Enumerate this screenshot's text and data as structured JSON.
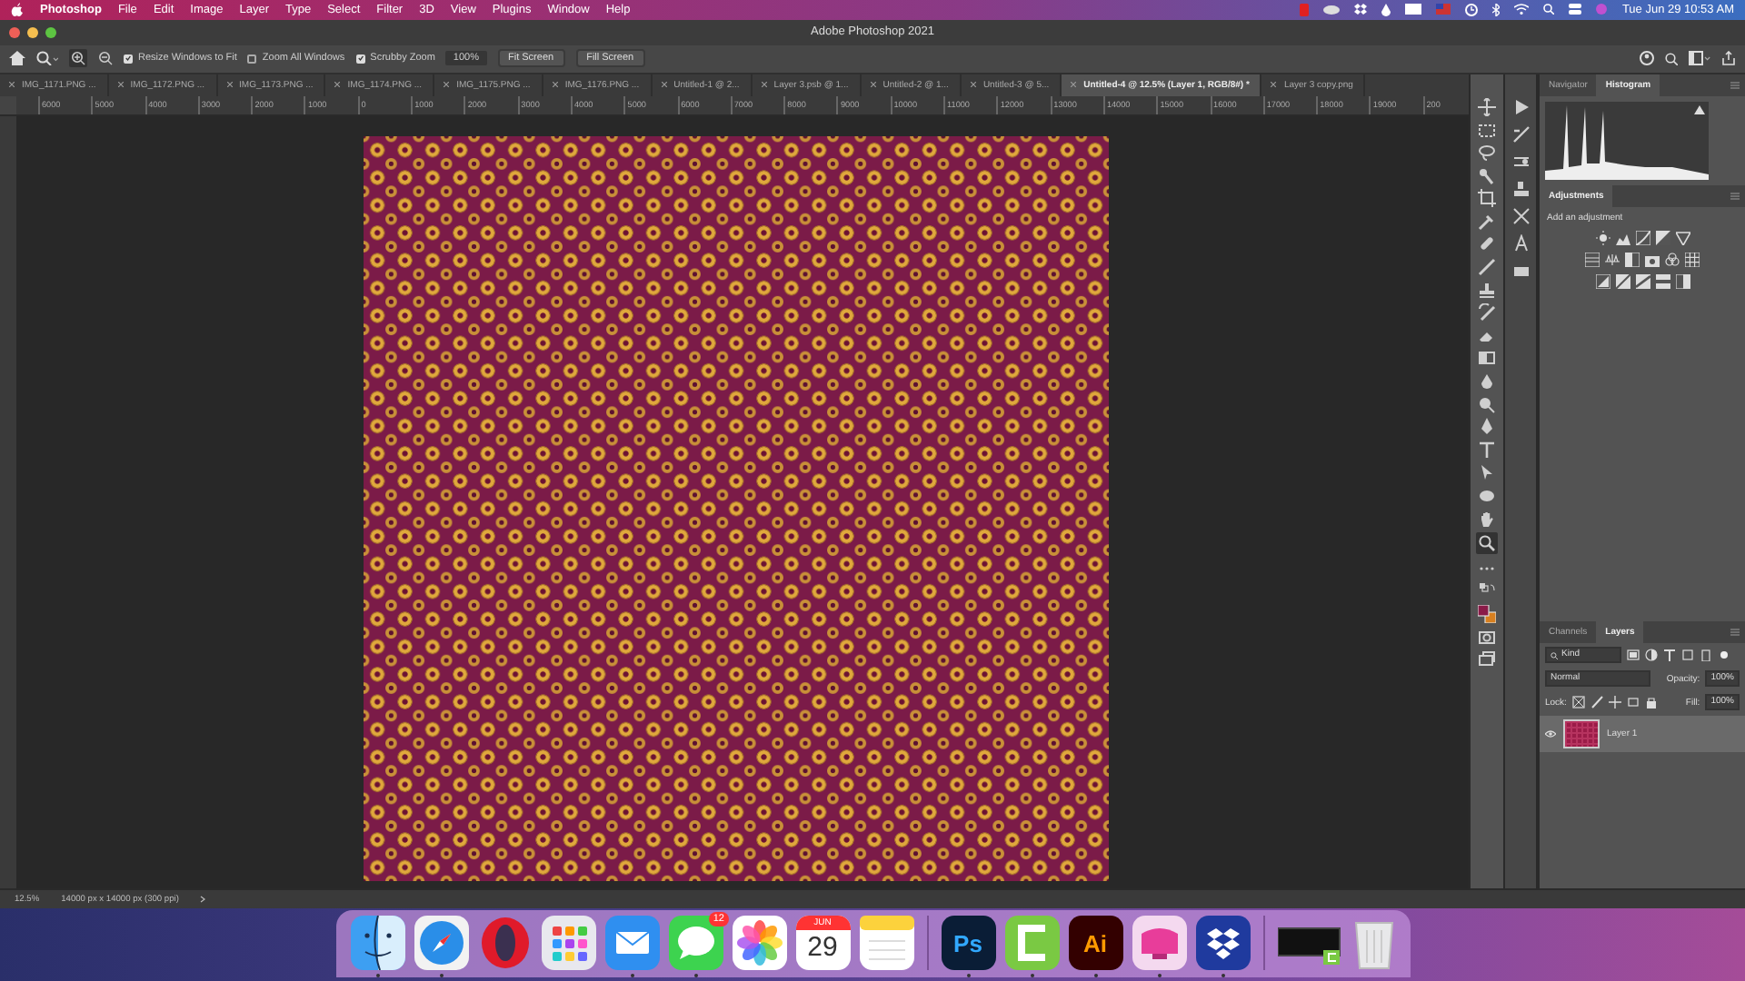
{
  "menu_bar": {
    "app": "Photoshop",
    "items": [
      "File",
      "Edit",
      "Image",
      "Layer",
      "Type",
      "Select",
      "Filter",
      "3D",
      "View",
      "Plugins",
      "Window",
      "Help"
    ],
    "clock": "Tue Jun 29  10:53 AM"
  },
  "window": {
    "title": "Adobe Photoshop 2021"
  },
  "options_bar": {
    "checkboxes": [
      {
        "label": "Resize Windows to Fit",
        "checked": true
      },
      {
        "label": "Zoom All Windows",
        "checked": false
      },
      {
        "label": "Scrubby Zoom",
        "checked": true
      }
    ],
    "zoom_value": "100%",
    "buttons": [
      "Fit Screen",
      "Fill Screen"
    ]
  },
  "tabs": [
    {
      "label": "IMG_1171.PNG ...",
      "selected": false
    },
    {
      "label": "IMG_1172.PNG ...",
      "selected": false
    },
    {
      "label": "IMG_1173.PNG ...",
      "selected": false
    },
    {
      "label": "IMG_1174.PNG ...",
      "selected": false
    },
    {
      "label": "IMG_1175.PNG ...",
      "selected": false
    },
    {
      "label": "IMG_1176.PNG ...",
      "selected": false
    },
    {
      "label": "Untitled-1 @ 2...",
      "selected": false
    },
    {
      "label": "Layer 3.psb @ 1...",
      "selected": false
    },
    {
      "label": "Untitled-2 @ 1...",
      "selected": false
    },
    {
      "label": "Untitled-3 @ 5...",
      "selected": false
    },
    {
      "label": "Untitled-4 @ 12.5% (Layer 1, RGB/8#) *",
      "selected": true
    },
    {
      "label": "Layer 3 copy.png",
      "selected": false
    }
  ],
  "ruler": [
    "6000",
    "5000",
    "4000",
    "3000",
    "2000",
    "1000",
    "0",
    "1000",
    "2000",
    "3000",
    "4000",
    "5000",
    "6000",
    "7000",
    "8000",
    "9000",
    "10000",
    "11000",
    "12000",
    "13000",
    "14000",
    "15000",
    "16000",
    "17000",
    "18000",
    "19000",
    "200"
  ],
  "histogram_panel": {
    "tabs": [
      {
        "label": "Navigator",
        "selected": false
      },
      {
        "label": "Histogram",
        "selected": true
      }
    ]
  },
  "adjustments_panel": {
    "title": "Adjustments",
    "hint": "Add an adjustment"
  },
  "layers_panel": {
    "tabs": [
      {
        "label": "Channels",
        "selected": false
      },
      {
        "label": "Layers",
        "selected": true
      }
    ],
    "filter": "Kind",
    "blend_mode": "Normal",
    "opacity_label": "Opacity:",
    "opacity": "100%",
    "lock_label": "Lock:",
    "fill_label": "Fill:",
    "fill": "100%",
    "layers": [
      {
        "name": "Layer 1",
        "visible": true,
        "selected": true
      }
    ]
  },
  "status_bar": {
    "zoom": "12.5%",
    "doc_size": "14000 px x 14000 px (300 ppi)"
  },
  "dock": [
    {
      "kind": "finder",
      "running": true
    },
    {
      "kind": "safari",
      "running": true
    },
    {
      "kind": "opera",
      "running": false
    },
    {
      "kind": "launchpad",
      "running": false
    },
    {
      "kind": "mail",
      "running": true
    },
    {
      "kind": "messages",
      "running": true,
      "badge": "12"
    },
    {
      "kind": "photos",
      "running": false
    },
    {
      "kind": "calendar",
      "running": false,
      "month": "JUN",
      "day": "29"
    },
    {
      "kind": "notes",
      "running": false
    },
    {
      "kind": "separator"
    },
    {
      "kind": "photoshop",
      "running": true,
      "label": "Ps"
    },
    {
      "kind": "camtasia",
      "running": true
    },
    {
      "kind": "illustrator",
      "running": true,
      "label": "Ai"
    },
    {
      "kind": "cleaner",
      "running": true
    },
    {
      "kind": "dropbox",
      "running": true
    },
    {
      "kind": "separator"
    },
    {
      "kind": "window-thumb",
      "running": false
    },
    {
      "kind": "trash",
      "running": false
    }
  ]
}
